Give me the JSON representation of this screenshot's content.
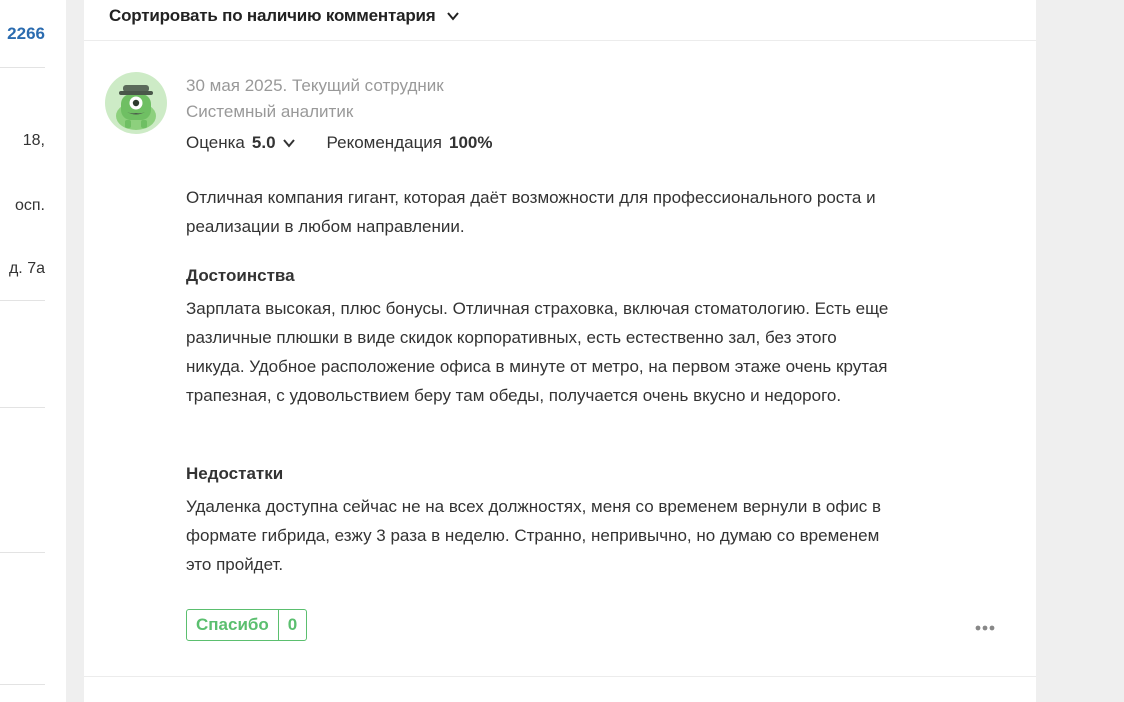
{
  "left_column": {
    "link_number": "2266",
    "fragments": [
      "18,",
      "осп.",
      "д. 7а"
    ]
  },
  "sort": {
    "label": "Сортировать по наличию комментария"
  },
  "review": {
    "meta_date": "30 мая 2025. Текущий сотрудник",
    "meta_role": "Системный аналитик",
    "rating_label": "Оценка",
    "rating_value": "5.0",
    "recommendation_label": "Рекомендация",
    "recommendation_value": "100%",
    "summary": "Отличная компания гигант, которая даёт возможности для профессионального роста и реализации в любом направлении.",
    "pros_heading": "Достоинства",
    "pros": "Зарплата высокая, плюс бонусы. Отличная страховка, включая стоматологию. Есть еще различные плюшки в виде скидок корпоративных, есть естественно зал, без этого никуда. Удобное расположение офиса в минуте от метро, на первом этаже очень крутая трапезная, с удовольствием беру там обеды, получается очень вкусно и недорого.",
    "cons_heading": "Недостатки",
    "cons": "Удаленка доступна сейчас не на всех должностях, меня со временем вернули в офис в формате гибрида, езжу 3 раза в неделю. Странно, непривычно, но думаю со временем это пройдет.",
    "thanks_label": "Спасибо",
    "thanks_count": "0"
  },
  "icons": {
    "sort": "chevron-down-icon",
    "rating": "chevron-down-icon",
    "more": "more-dots-icon",
    "avatar": "avatar-icon"
  },
  "colors": {
    "link": "#2b6cb0",
    "accent_green": "#5bbf6f",
    "muted_text": "#999999",
    "avatar_bg": "#cdebc6"
  }
}
